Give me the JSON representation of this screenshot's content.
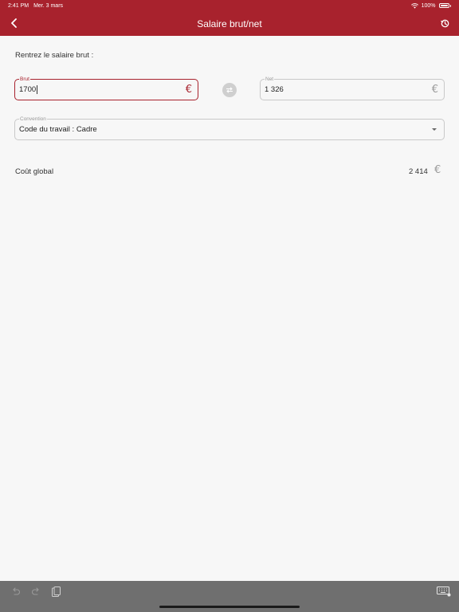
{
  "status": {
    "time": "2:41 PM",
    "date": "Mer. 3 mars",
    "battery": "100%"
  },
  "header": {
    "title": "Salaire brut/net"
  },
  "form": {
    "prompt": "Rentrez le salaire brut :",
    "brut": {
      "label": "Brut",
      "value": "1700",
      "currency": "€"
    },
    "net": {
      "label": "Net",
      "value": "1 326",
      "currency": "€"
    },
    "convention": {
      "label": "Convention",
      "value": "Code du travail : Cadre"
    }
  },
  "cout_global": {
    "label": "Coût global",
    "value": "2 414",
    "currency": "€"
  },
  "colors": {
    "brand": "#a8222d",
    "background": "#f7f7f7",
    "accessory_bar": "#6f6f6f"
  },
  "icons": {
    "back": "chevron-left-icon",
    "history": "history-icon",
    "swap": "swap-icon",
    "undo": "undo-icon",
    "redo": "redo-icon",
    "paste": "clipboard-icon",
    "keyboard": "keyboard-icon"
  }
}
